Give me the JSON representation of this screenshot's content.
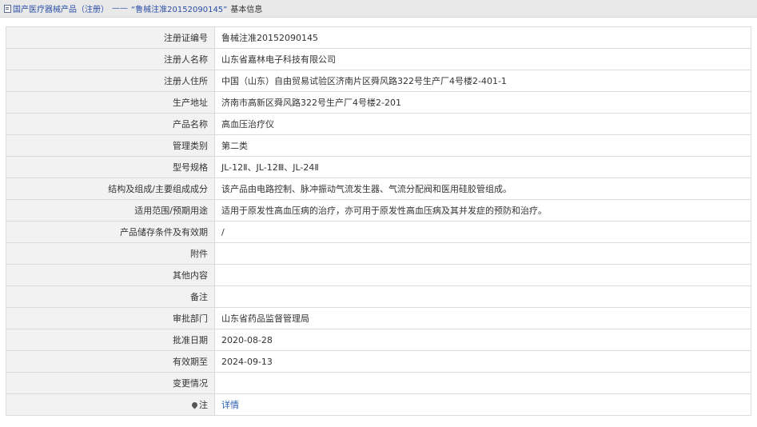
{
  "breadcrumb": {
    "root": "国产医疗器械产品（注册）",
    "separator": "——",
    "current": "“鲁械注准20152090145”",
    "tail": "基本信息"
  },
  "rows": [
    {
      "label": "注册证编号",
      "value": "鲁械注准20152090145"
    },
    {
      "label": "注册人名称",
      "value": "山东省嘉林电子科技有限公司"
    },
    {
      "label": "注册人住所",
      "value": "中国（山东）自由贸易试验区济南片区舜风路322号生产厂4号楼2-401-1"
    },
    {
      "label": "生产地址",
      "value": "济南市高新区舜风路322号生产厂4号楼2-201"
    },
    {
      "label": "产品名称",
      "value": "高血压治疗仪"
    },
    {
      "label": "管理类别",
      "value": "第二类"
    },
    {
      "label": "型号规格",
      "value": "JL-12Ⅱ、JL-12Ⅲ、JL-24Ⅱ"
    },
    {
      "label": "结构及组成/主要组成成分",
      "value": "该产品由电路控制、脉冲振动气流发生器、气流分配阀和医用硅胶管组成。"
    },
    {
      "label": "适用范围/预期用途",
      "value": "适用于原发性高血压病的治疗，亦可用于原发性高血压病及其并发症的预防和治疗。"
    },
    {
      "label": "产品储存条件及有效期",
      "value": "/"
    },
    {
      "label": "附件",
      "value": ""
    },
    {
      "label": "其他内容",
      "value": ""
    },
    {
      "label": "备注",
      "value": ""
    },
    {
      "label": "审批部门",
      "value": "山东省药品监督管理局"
    },
    {
      "label": "批准日期",
      "value": "2020-08-28"
    },
    {
      "label": "有效期至",
      "value": "2024-09-13"
    },
    {
      "label": "变更情况",
      "value": ""
    }
  ],
  "note_row": {
    "label": "注",
    "icon": "pin-icon",
    "link_text": "详情"
  },
  "colors": {
    "label_bg": "#f2f2f2",
    "border": "#dcdcdc",
    "link": "#2a5db0",
    "topbar_bg": "#e9e9e9"
  }
}
